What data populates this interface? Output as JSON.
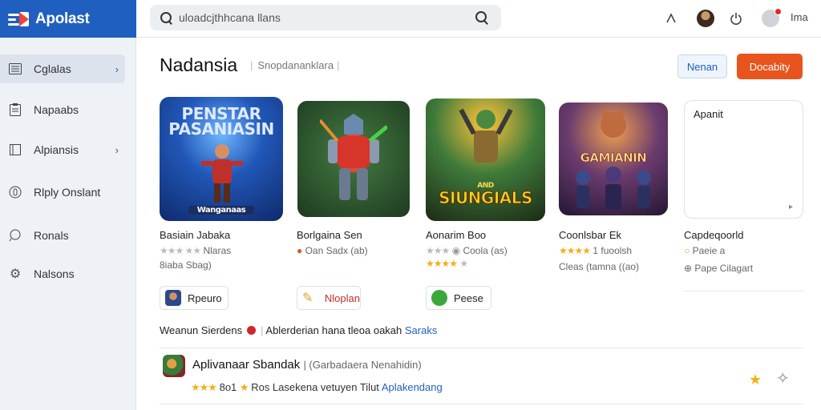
{
  "app": {
    "logo_text": "Apolast"
  },
  "search": {
    "placeholder": "uloadcjthhcana llans"
  },
  "header": {
    "user_text": "Ima"
  },
  "sidebar": {
    "items": [
      {
        "label": "Cglalas",
        "icon": "list-icon",
        "active": true
      },
      {
        "label": "Napaabs",
        "icon": "clipboard-icon",
        "active": false
      },
      {
        "label": "Alpiansis",
        "icon": "square-icon",
        "active": false
      },
      {
        "label": "Rlply Onslant",
        "icon": "circle-icon",
        "active": false
      },
      {
        "label": "Ronals",
        "icon": "chat-icon",
        "active": false
      },
      {
        "label": "Nalsons",
        "icon": "gear-icon",
        "active": false
      }
    ]
  },
  "main": {
    "title": "Nadansia",
    "subtitle": "Snopdananklara",
    "btn_secondary": "Nenan",
    "btn_primary": "Docabity",
    "cards": [
      {
        "overlay": "PENSTAR PASANIASIN",
        "overlay2": "Wanganaas",
        "title": "Basiain Jabaka",
        "meta1": "Nlaras",
        "meta2": "8iaba Sbag)"
      },
      {
        "overlay": "",
        "overlay2": "",
        "title": "Borlgaina Sen",
        "meta1": "Oan  Sadx (ab)",
        "meta2": ""
      },
      {
        "overlay": "SIUNGIALS",
        "overlay2": "AND",
        "title": "Aonarim Boo",
        "meta1": "Coola (as)",
        "meta2": ""
      },
      {
        "overlay": "GAMIANIN",
        "overlay2": "",
        "title": "Coonlsbar Ek",
        "meta1": "1 fuoolsh",
        "meta2": "Cleas (tamna ((ao)"
      },
      {
        "overlay": "",
        "overlay2": "",
        "title": "Capdeqoorld",
        "meta1": "Paeie a",
        "meta2": "Pape Cilagart"
      }
    ],
    "ad_card_label": "Apanit",
    "chips": [
      {
        "label": "Rpeuro"
      },
      {
        "label": "Nloplan"
      },
      {
        "label": "Peese"
      }
    ],
    "section": {
      "text_a": "Weanun Sierdens",
      "text_b": "Ablerderian hana tleoa oakah",
      "link": "Saraks"
    },
    "list_item": {
      "title": "Aplivanaar Sbandak",
      "subtitle": "Garbadaera Nenahidin",
      "meta_a": "8o1",
      "meta_b": "Ros Lasekena vetuyen Tilut",
      "link": "Aplakendang"
    }
  },
  "colors": {
    "brand": "#1f5fbf",
    "primary_button": "#e8541e",
    "star": "#f0b017",
    "notification": "#e0282a"
  }
}
